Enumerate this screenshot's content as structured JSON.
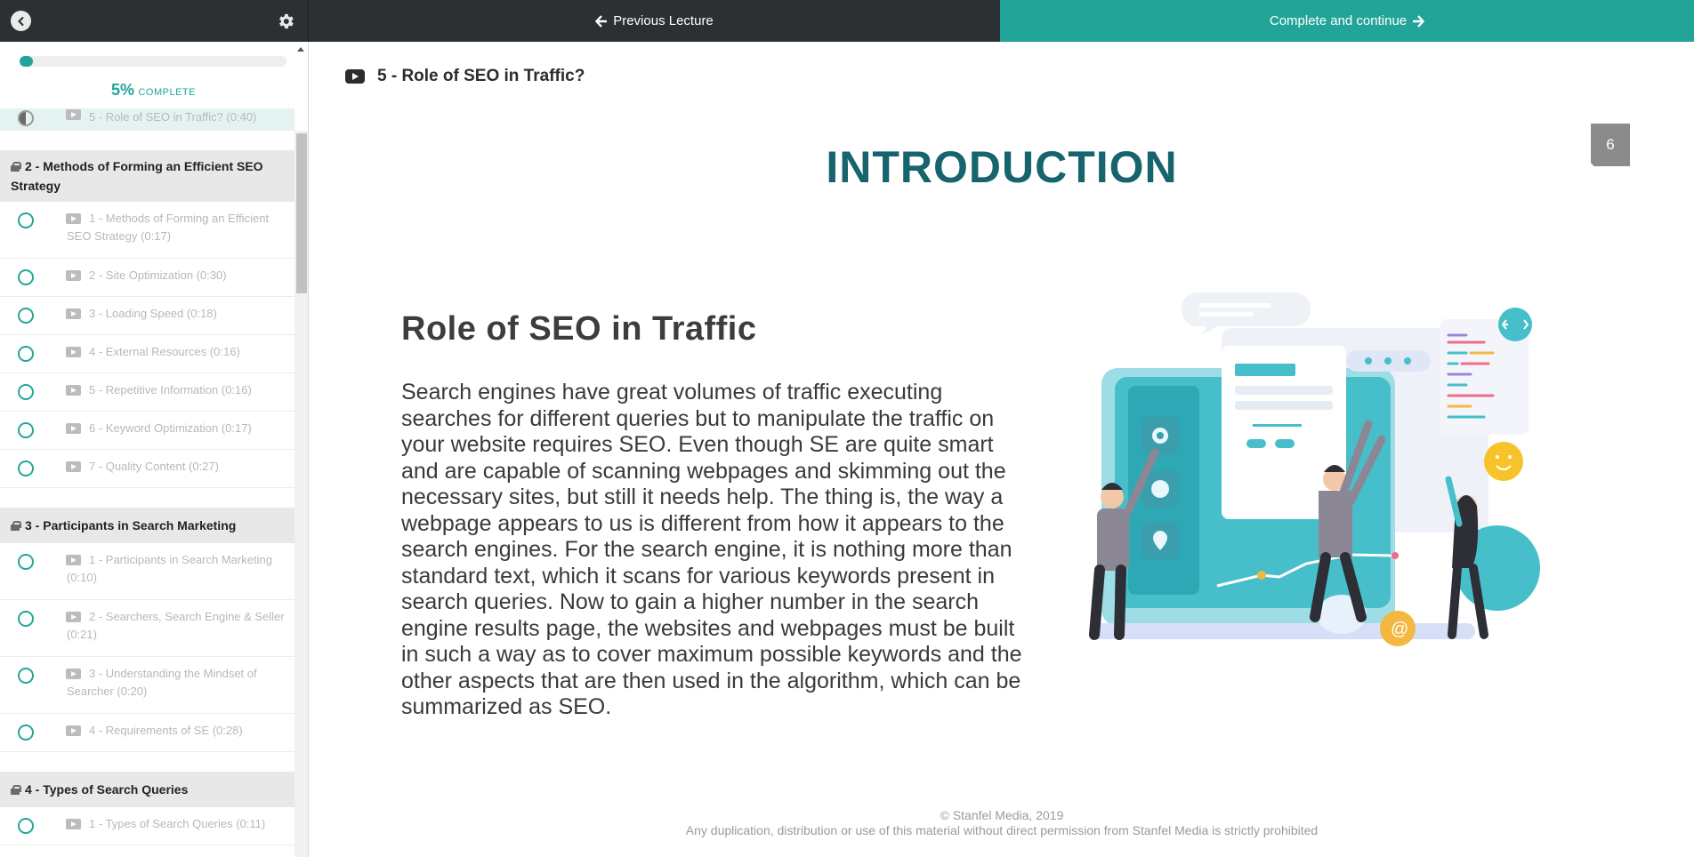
{
  "topbar": {
    "prev_label": "Previous Lecture",
    "next_label": "Complete and continue",
    "accent_color": "#22a598",
    "dark_color": "#2c3032"
  },
  "sidebar": {
    "progress": {
      "percent_value": 5,
      "percent_text": "5%",
      "label": "COMPLETE"
    },
    "current_lecture": "5 - Role of SEO in Traffic? (0:40)",
    "sections": [
      {
        "title": "2 - Methods of Forming an Efficient SEO Strategy",
        "lectures": [
          "1 - Methods of Forming an Efficient SEO Strategy (0:17)",
          "2 - Site Optimization (0:30)",
          "3 - Loading Speed (0:18)",
          "4 - External Resources (0:16)",
          "5 - Repetitive Information (0:16)",
          "6 - Keyword Optimization (0:17)",
          "7 - Quality Content (0:27)"
        ]
      },
      {
        "title": "3 - Participants in Search Marketing",
        "lectures": [
          "1 - Participants in Search Marketing (0:10)",
          "2 - Searchers, Search Engine & Seller (0:21)",
          "3 - Understanding the Mindset of Searcher (0:20)",
          "4 - Requirements of SE (0:28)"
        ]
      },
      {
        "title": "4 - Types of Search Queries",
        "lectures": [
          "1 - Types of Search Queries (0:11)"
        ]
      }
    ]
  },
  "main": {
    "lecture_title": "5 - Role of SEO in Traffic?",
    "slide": {
      "number": "6",
      "heading": "INTRODUCTION",
      "subheading": "Role of SEO in Traffic",
      "body": "Search engines have great volumes of traffic executing searches for different queries but to manipulate the traffic on your website requires SEO. Even though SE are quite smart and are capable of scanning webpages and skimming out the necessary sites, but still it needs help. The thing is, the way a webpage appears to us is different from how it appears to the search engines. For the search engine, it is nothing more than standard text, which it scans for various keywords present in search queries. Now to gain a higher number in the search engine results page, the websites and webpages must be built in such a way as to cover maximum possible keywords and the other aspects that are then used in the algorithm, which can be summarized as SEO.",
      "illustration_icon": "seo-team-illustration",
      "copyright": "© Stanfel Media, 2019",
      "notice": "Any duplication, distribution or use of this material without direct permission from Stanfel Media is strictly prohibited"
    }
  }
}
